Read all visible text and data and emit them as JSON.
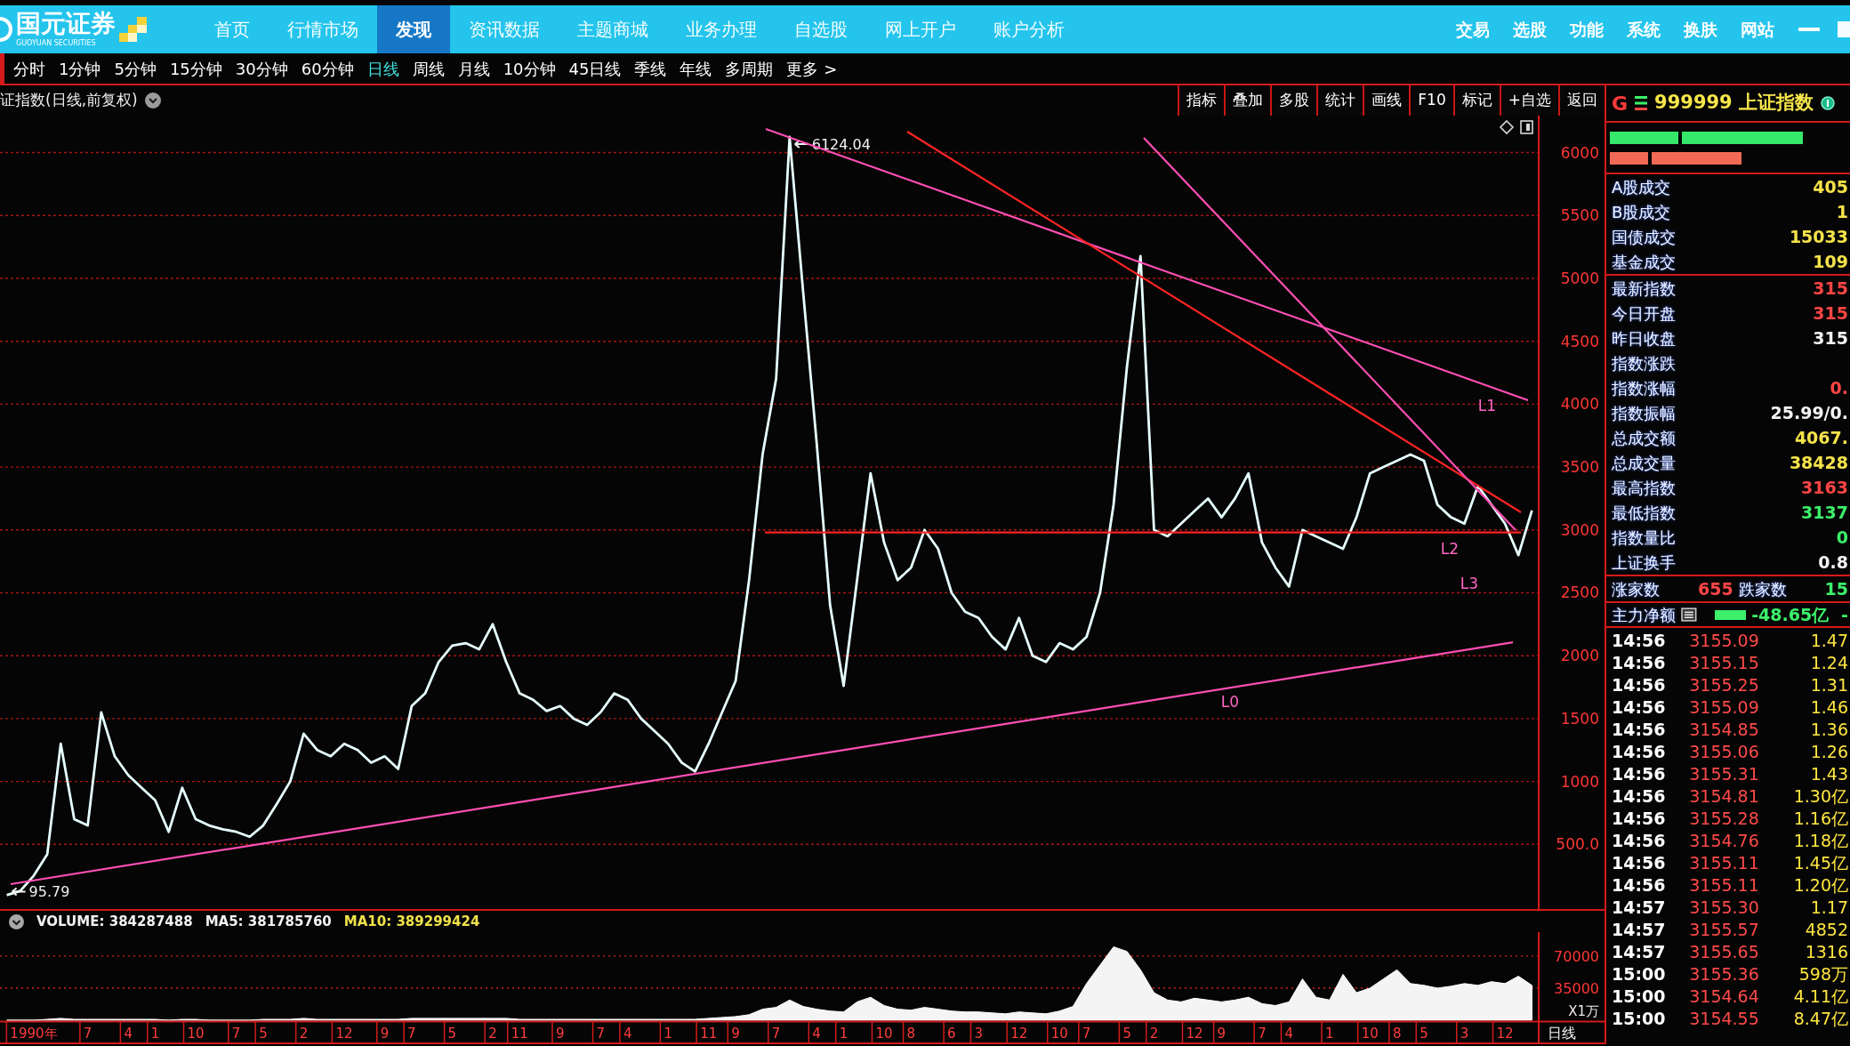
{
  "app_bar": {
    "brand": {
      "name": "国元证券",
      "subtitle": "GUOYUAN SECURITIES"
    },
    "nav": [
      {
        "label": "首页",
        "selected": false
      },
      {
        "label": "行情市场",
        "selected": false
      },
      {
        "label": "发现",
        "selected": true
      },
      {
        "label": "资讯数据",
        "selected": false
      },
      {
        "label": "主题商城",
        "selected": false
      },
      {
        "label": "业务办理",
        "selected": false
      },
      {
        "label": "自选股",
        "selected": false
      },
      {
        "label": "网上开户",
        "selected": false
      },
      {
        "label": "账户分析",
        "selected": false
      }
    ],
    "menu": [
      "交易",
      "选股",
      "功能",
      "系统",
      "换肤",
      "网站"
    ]
  },
  "period_tabs": [
    {
      "label": "分时",
      "selected": false
    },
    {
      "label": "1分钟",
      "selected": false
    },
    {
      "label": "5分钟",
      "selected": false
    },
    {
      "label": "15分钟",
      "selected": false
    },
    {
      "label": "30分钟",
      "selected": false
    },
    {
      "label": "60分钟",
      "selected": false
    },
    {
      "label": "日线",
      "selected": true
    },
    {
      "label": "周线",
      "selected": false
    },
    {
      "label": "月线",
      "selected": false
    },
    {
      "label": "10分钟",
      "selected": false
    },
    {
      "label": "45日线",
      "selected": false
    },
    {
      "label": "季线",
      "selected": false
    },
    {
      "label": "年线",
      "selected": false
    },
    {
      "label": "多周期",
      "selected": false
    },
    {
      "label": "更多 >",
      "selected": false
    }
  ],
  "chart_header": {
    "title": "证指数(日线,前复权)"
  },
  "toolbar": [
    "指标",
    "叠加",
    "多股",
    "统计",
    "画线",
    "F10",
    "标记",
    "+自选",
    "返回"
  ],
  "price_chart": {
    "chart_data": {
      "type": "line",
      "categories": [
        null,
        null,
        null,
        null,
        null,
        null,
        null,
        null,
        null,
        null,
        null,
        null,
        null,
        null,
        null,
        null,
        null,
        null,
        null,
        null,
        null,
        null,
        null,
        null,
        null,
        null,
        null,
        null,
        null,
        null,
        null,
        null,
        null,
        null,
        null,
        null,
        null,
        null,
        null,
        null,
        null,
        null,
        null,
        null,
        null,
        null,
        null,
        null,
        null,
        null,
        null,
        null,
        null,
        null,
        null,
        null,
        null,
        null,
        null,
        null,
        null,
        null,
        null,
        null,
        null,
        null,
        null,
        null,
        null,
        null,
        null,
        null,
        null,
        null,
        null,
        null,
        null,
        null,
        null,
        null,
        null,
        null,
        null,
        null,
        null,
        null,
        null,
        null,
        null,
        null,
        null,
        null,
        null,
        null,
        null,
        null,
        null,
        null,
        null,
        null,
        null,
        null,
        null,
        null,
        null,
        null,
        null,
        null,
        null,
        null,
        null,
        null,
        null,
        null
      ],
      "values": [
        96,
        130,
        250,
        420,
        1300,
        700,
        650,
        1550,
        1200,
        1050,
        950,
        850,
        600,
        950,
        700,
        650,
        620,
        600,
        560,
        650,
        820,
        1000,
        1380,
        1250,
        1200,
        1300,
        1250,
        1150,
        1200,
        1100,
        1600,
        1700,
        1950,
        2080,
        2100,
        2050,
        2250,
        1950,
        1700,
        1650,
        1560,
        1600,
        1500,
        1450,
        1550,
        1700,
        1650,
        1500,
        1400,
        1300,
        1150,
        1080,
        1300,
        1550,
        1800,
        2600,
        3600,
        4200,
        6124,
        4900,
        3700,
        2400,
        1760,
        2600,
        3450,
        2900,
        2600,
        2700,
        3000,
        2850,
        2500,
        2350,
        2300,
        2150,
        2050,
        2300,
        2000,
        1950,
        2100,
        2050,
        2150,
        2500,
        3200,
        4300,
        5178,
        3000,
        2950,
        3050,
        3150,
        3250,
        3100,
        3250,
        3450,
        2900,
        2700,
        2550,
        3000,
        2950,
        2900,
        2850,
        3100,
        3450,
        3500,
        3550,
        3600,
        3550,
        3200,
        3100,
        3050,
        3350,
        3200,
        3050,
        2800,
        3155
      ],
      "ylim": [
        0,
        6294
      ],
      "yticks": [
        {
          "value": 500,
          "label": "500.0"
        },
        1000,
        1500,
        2000,
        2500,
        3000,
        3500,
        4000,
        4500,
        5000,
        5500,
        6000
      ],
      "grid": true,
      "annotations": [
        "6124.04",
        "95.79"
      ]
    },
    "line_labels": [
      "L0",
      "L1",
      "L2",
      "L3"
    ]
  },
  "volume_pane": {
    "legend": [
      {
        "label": "VOLUME: 384287488",
        "color": "#f2f2f2"
      },
      {
        "label": "MA5: 381785760",
        "color": "#f2f2f2"
      },
      {
        "label": "MA10: 389299424",
        "color": "#f0e24a"
      }
    ],
    "chart_data": {
      "type": "area",
      "categories": [
        null,
        null,
        "1990年",
        null,
        null,
        null,
        "7",
        null,
        null,
        "4",
        null,
        "1",
        null,
        null,
        "10",
        null,
        null,
        "7",
        null,
        "5",
        null,
        null,
        "2",
        null,
        null,
        "12",
        null,
        null,
        "9",
        null,
        "7",
        null,
        null,
        "5",
        null,
        null,
        "2",
        null,
        "11",
        null,
        null,
        "9",
        null,
        null,
        "7",
        null,
        "4",
        null,
        null,
        "1",
        null,
        null,
        "11",
        null,
        "9",
        null,
        null,
        "7",
        null,
        null,
        "4",
        null,
        "1",
        null,
        null,
        "10",
        null,
        "8",
        null,
        null,
        "6",
        null,
        "3",
        null,
        null,
        "12",
        null,
        null,
        "10",
        null,
        "7",
        null,
        null,
        "5",
        null,
        "2",
        null,
        null,
        "12",
        null,
        "9",
        null,
        null,
        "7",
        null,
        "4",
        null,
        null,
        "1",
        null,
        null,
        "10",
        null,
        "8",
        null,
        "5",
        null,
        null,
        "3",
        null,
        null,
        "12",
        null,
        null
      ],
      "values": [
        0,
        0,
        0,
        1000,
        2000,
        1000,
        1000,
        1000,
        1000,
        1000,
        1000,
        1000,
        0,
        1000,
        1000,
        0,
        0,
        0,
        0,
        1000,
        1000,
        1000,
        2000,
        1000,
        1000,
        1000,
        1000,
        1000,
        1000,
        1000,
        2000,
        2000,
        2000,
        2000,
        2000,
        2000,
        2000,
        2000,
        1000,
        1000,
        1000,
        1000,
        1000,
        1000,
        1000,
        1000,
        1000,
        1000,
        1000,
        1000,
        1000,
        1000,
        2000,
        3000,
        4000,
        6000,
        12000,
        14000,
        22000,
        15000,
        12000,
        10000,
        9000,
        20000,
        25000,
        16000,
        12000,
        11000,
        14000,
        12000,
        10000,
        9000,
        9000,
        8000,
        7000,
        9000,
        8000,
        7000,
        10000,
        15000,
        40000,
        60000,
        80000,
        75000,
        55000,
        30000,
        22000,
        20000,
        24000,
        22000,
        20000,
        22000,
        25000,
        18000,
        16000,
        20000,
        45000,
        25000,
        22000,
        50000,
        30000,
        35000,
        45000,
        55000,
        40000,
        38000,
        35000,
        37000,
        40000,
        38000,
        42000,
        40000,
        48000,
        38000
      ],
      "ylim": [
        0,
        96000
      ],
      "yticks": [
        35000,
        70000
      ],
      "grid": true,
      "ylabel": "X1万",
      "xlabel": "日线"
    }
  },
  "quote_panel": {
    "header": {
      "market": "G",
      "title": "999999 上证指数"
    },
    "strength_bars": [
      {
        "kind": "up",
        "segments": [
          {
            "level": 0.29
          },
          {
            "level": 0.51
          }
        ]
      },
      {
        "kind": "down",
        "segments": [
          {
            "level": 0.16
          },
          {
            "level": 0.38
          }
        ]
      }
    ],
    "turnover": [
      {
        "label": "A股成交",
        "value": "405"
      },
      {
        "label": "B股成交",
        "value": "1"
      },
      {
        "label": "国债成交",
        "value": "15033"
      },
      {
        "label": "基金成交",
        "value": "109"
      }
    ],
    "index_stats": [
      {
        "label": "最新指数",
        "value": "315",
        "color": "#ff4545"
      },
      {
        "label": "今日开盘",
        "value": "315",
        "color": "#ff4545"
      },
      {
        "label": "昨日收盘",
        "value": "315",
        "color": "#f2f2f2"
      },
      {
        "label": "指数涨跌"
      },
      {
        "label": "指数涨幅",
        "value": "0.",
        "color": "#ff4545"
      },
      {
        "label": "指数振幅",
        "value": "25.99/0.",
        "color": "#f2f2f2"
      },
      {
        "label": "总成交额",
        "value": "4067.",
        "color": "#f4e24a"
      },
      {
        "label": "总成交量",
        "value": "38428",
        "color": "#f4e24a"
      },
      {
        "label": "最高指数",
        "value": "3163",
        "color": "#ff4545"
      },
      {
        "label": "最低指数",
        "value": "3137",
        "color": "#3cf06a"
      },
      {
        "label": "指数量比",
        "value": "0",
        "color": "#3cf06a"
      },
      {
        "label": "上证换手",
        "value": "0.8",
        "color": "#f2f2f2"
      }
    ],
    "breadth": [
      {
        "label": "涨家数",
        "value": "655",
        "color": "#ff4545"
      },
      {
        "label": "跌家数",
        "value": "15",
        "color": "#3cf06a"
      }
    ],
    "main_force": {
      "label": "主力净额",
      "outflow": true,
      "value": "-48.65亿",
      "column_3": "-"
    },
    "ticks": [
      {
        "time": "14:56",
        "price": "3155.09",
        "amount": "1.47"
      },
      {
        "time": "14:56",
        "price": "3155.15",
        "amount": "1.24"
      },
      {
        "time": "14:56",
        "price": "3155.25",
        "amount": "1.31"
      },
      {
        "time": "14:56",
        "price": "3155.09",
        "amount": "1.46"
      },
      {
        "time": "14:56",
        "price": "3154.85",
        "amount": "1.36"
      },
      {
        "time": "14:56",
        "price": "3155.06",
        "amount": "1.26"
      },
      {
        "time": "14:56",
        "price": "3155.31",
        "amount": "1.43"
      },
      {
        "time": "14:56",
        "price": "3154.81",
        "amount": "1.30亿"
      },
      {
        "time": "14:56",
        "price": "3155.28",
        "amount": "1.16亿"
      },
      {
        "time": "14:56",
        "price": "3154.76",
        "amount": "1.18亿"
      },
      {
        "time": "14:56",
        "price": "3155.11",
        "amount": "1.45亿"
      },
      {
        "time": "14:56",
        "price": "3155.11",
        "amount": "1.20亿"
      },
      {
        "time": "14:57",
        "price": "3155.30",
        "amount": "1.17"
      },
      {
        "time": "14:57",
        "price": "3155.57",
        "amount": "4852"
      },
      {
        "time": "14:57",
        "price": "3155.65",
        "amount": "1316"
      },
      {
        "time": "15:00",
        "price": "3155.36",
        "amount": "598万"
      },
      {
        "time": "15:00",
        "price": "3154.64",
        "amount": "4.11亿"
      },
      {
        "time": "15:00",
        "price": "3154.55",
        "amount": "8.47亿"
      }
    ]
  }
}
